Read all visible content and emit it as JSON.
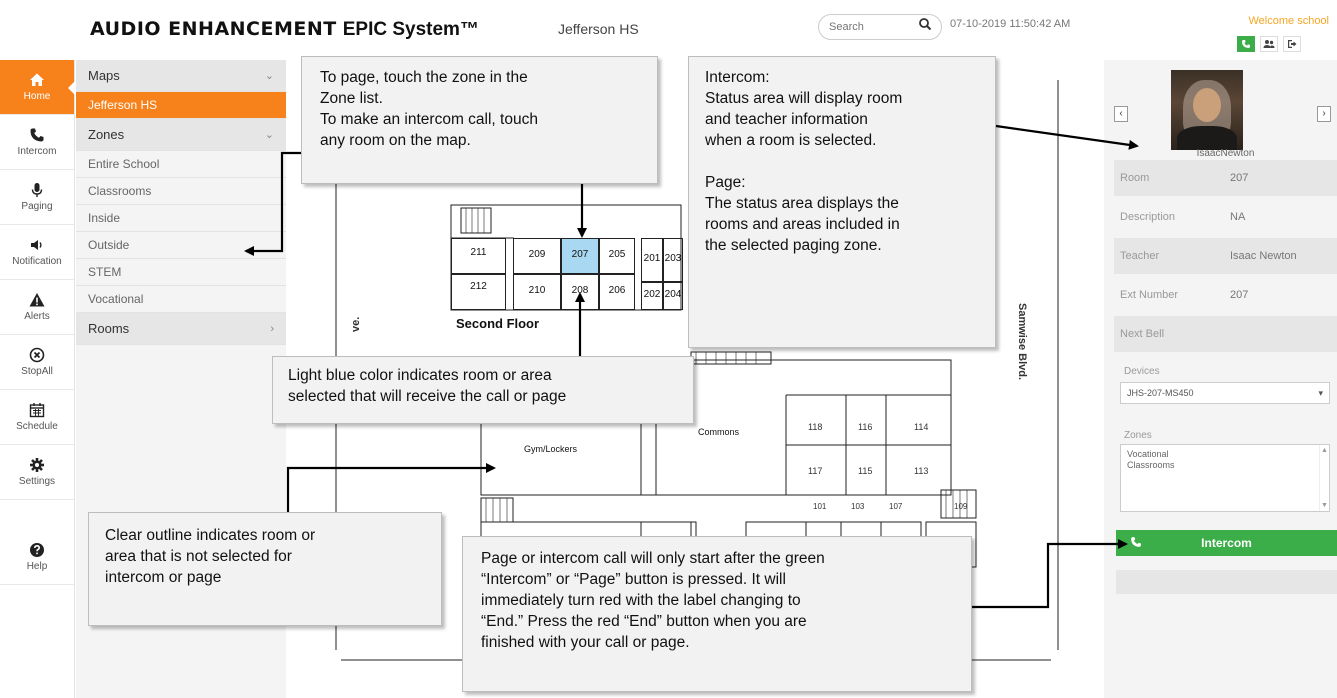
{
  "header": {
    "brand": "AUDIO ENHANCEMENT",
    "product": "EPIC System™",
    "school": "Jefferson HS",
    "search_placeholder": "Search",
    "datetime": "07-10-2019 11:50:42 AM",
    "welcome": "Welcome school"
  },
  "nav": {
    "items": [
      {
        "label": "Home",
        "icon": "home-icon"
      },
      {
        "label": "Intercom",
        "icon": "phone-icon"
      },
      {
        "label": "Paging",
        "icon": "microphone-icon"
      },
      {
        "label": "Notification",
        "icon": "speaker-icon"
      },
      {
        "label": "Alerts",
        "icon": "warning-icon"
      },
      {
        "label": "StopAll",
        "icon": "stop-icon"
      },
      {
        "label": "Schedule",
        "icon": "calendar-icon"
      },
      {
        "label": "Settings",
        "icon": "gear-icon"
      },
      {
        "label": "Help",
        "icon": "help-icon"
      }
    ]
  },
  "sidebar": {
    "maps_title": "Maps",
    "map_selected": "Jefferson HS",
    "zones_title": "Zones",
    "zones": [
      "Entire School",
      "Classrooms",
      "Inside",
      "Outside",
      "STEM",
      "Vocational"
    ],
    "rooms_title": "Rooms"
  },
  "map": {
    "floor_label": "Second Floor",
    "street_right": "Samwise Blvd.",
    "street_left": "ve.",
    "gym_label": "Gym/Lockers",
    "commons_label": "Commons",
    "selected_room": "207",
    "rooms_top": [
      "211",
      "209",
      "207",
      "205",
      "201",
      "203"
    ],
    "rooms_bottom": [
      "212",
      "210",
      "208",
      "206",
      "202",
      "204"
    ],
    "rooms_first": [
      "118",
      "116",
      "114",
      "117",
      "115",
      "113"
    ],
    "rooms_lower": [
      "101",
      "103",
      "107",
      "109"
    ]
  },
  "status": {
    "teacher_caption": "IsaacNewton",
    "rows": [
      {
        "label": "Room",
        "value": "207"
      },
      {
        "label": "Description",
        "value": "NA"
      },
      {
        "label": "Teacher",
        "value": "Isaac Newton"
      },
      {
        "label": "Ext Number",
        "value": "207"
      },
      {
        "label": "Next Bell",
        "value": ""
      }
    ],
    "devices_label": "Devices",
    "device_selected": "JHS-207-MS450",
    "zones_label": "Zones",
    "zones_list": [
      "Vocational",
      "Classrooms"
    ],
    "intercom_button": "Intercom"
  },
  "callouts": {
    "page_touch": [
      "To page, touch the zone in the",
      "Zone list.",
      "To make an intercom call, touch",
      "any room on the map."
    ],
    "intercom_info": [
      "Intercom:",
      "Status area will display room",
      "and teacher information",
      "when a room is selected.",
      "",
      "Page:",
      "The status area displays the",
      "rooms and areas included in",
      "the selected paging zone."
    ],
    "light_blue": [
      "Light blue color indicates room or area",
      "selected that will receive the call or page"
    ],
    "clear_outline": [
      "Clear outline indicates room or",
      "area that is not selected for",
      "intercom or page"
    ],
    "start_call": [
      "Page or intercom call will only start after the green",
      "“Intercom” or “Page” button is pressed. It will",
      "immediately turn red with the label changing to",
      "“End.” Press the red “End” button when you are",
      "finished with your call or page."
    ]
  },
  "colors": {
    "accent_orange": "#f7821b",
    "green": "#3cae49",
    "selected_room": "#a9d8f2",
    "welcome": "#f5a623"
  }
}
